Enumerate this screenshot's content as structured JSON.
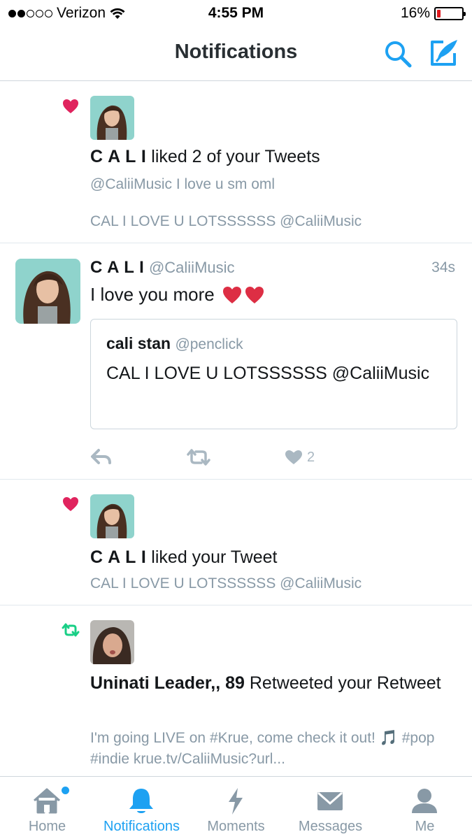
{
  "status_bar": {
    "carrier": "Verizon",
    "time": "4:55 PM",
    "battery": "16%",
    "battery_level": 0.16,
    "signal_bars_filled": 2,
    "signal_bars_total": 5
  },
  "nav": {
    "title": "Notifications",
    "icons": [
      "search-icon",
      "compose-tweet-icon"
    ],
    "accent_color": "#1da1f2"
  },
  "notifications": [
    {
      "type": "like",
      "icon": "heart-icon",
      "actor": "C A L I",
      "action": " liked 2 of your Tweets",
      "lines": [
        "@CaliiMusic I love u sm oml",
        "CAL I LOVE U LOTSSSSSS @CaliiMusic"
      ]
    },
    {
      "type": "tweet",
      "name": "C A L I",
      "handle": "@CaliiMusic",
      "time": "34s",
      "text": "I love you more",
      "emoji": "❤️❤️",
      "quote": {
        "name": "cali stan",
        "handle": "@penclick",
        "text": "CAL I LOVE U LOTSSSSSS @CaliiMusic"
      },
      "like_count": "2"
    },
    {
      "type": "like",
      "icon": "heart-icon",
      "actor": "C A L I",
      "action": " liked your Tweet",
      "lines": [
        "CAL I LOVE U LOTSSSSSS @CaliiMusic"
      ]
    },
    {
      "type": "retweet",
      "icon": "retweet-icon",
      "actor": "Uninati Leader,, 89",
      "action": " Retweeted your Retweet",
      "lines": [
        "I'm going LIVE on #Krue, come check it out! 🎵 #pop #indie krue.tv/CaliiMusic?url..."
      ]
    }
  ],
  "tabs": [
    {
      "label": "Home",
      "icon": "home-icon",
      "badge_dot": true
    },
    {
      "label": "Notifications",
      "icon": "bell-icon",
      "active": true
    },
    {
      "label": "Moments",
      "icon": "lightning-icon"
    },
    {
      "label": "Messages",
      "icon": "envelope-icon"
    },
    {
      "label": "Me",
      "icon": "person-icon"
    }
  ],
  "colors": {
    "like": "#e0245e",
    "retweet": "#19cf86",
    "secondary_text": "#8899a6",
    "icon_grey": "#aab8c2"
  }
}
